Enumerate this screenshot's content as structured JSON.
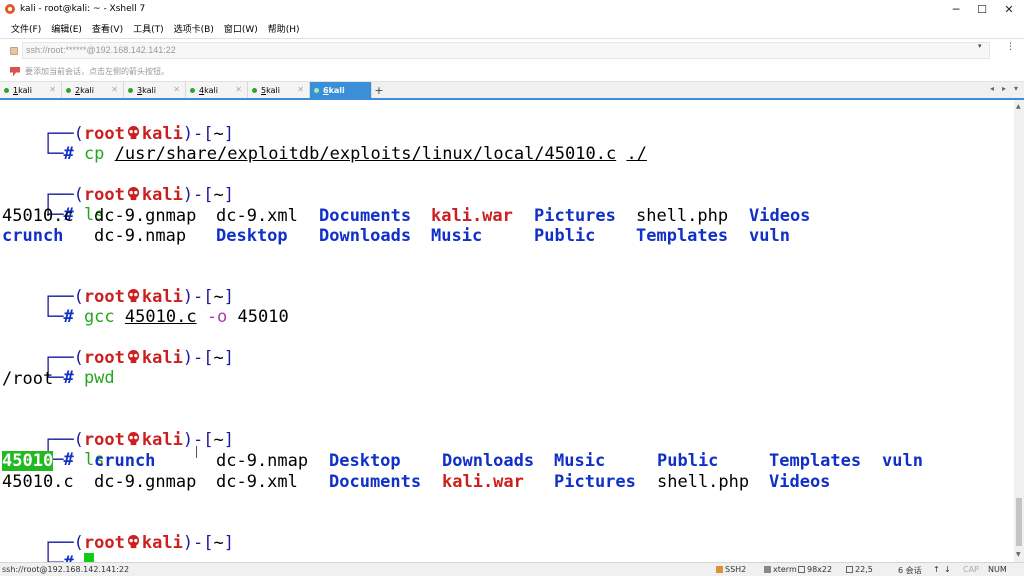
{
  "window": {
    "title": "kali - root@kali: ~ - Xshell 7",
    "minimize": "─",
    "maximize": "☐",
    "close": "✕"
  },
  "menu": [
    "文件(F)",
    "编辑(E)",
    "查看(V)",
    "工具(T)",
    "选项卡(B)",
    "窗口(W)",
    "帮助(H)"
  ],
  "address": {
    "value": "ssh://root:******@192.168.142.141:22",
    "dropdown": "▾",
    "more": "⋮"
  },
  "hint": "要添加当前会话，点击左侧的箭头按钮。",
  "tabs": [
    {
      "num": "1",
      "name": " kali",
      "active": false
    },
    {
      "num": "2",
      "name": " kali",
      "active": false
    },
    {
      "num": "3",
      "name": " kali",
      "active": false
    },
    {
      "num": "4",
      "name": " kali",
      "active": false
    },
    {
      "num": "5",
      "name": " kali",
      "active": false
    },
    {
      "num": "6",
      "name": " kali",
      "active": true
    }
  ],
  "tab_close": "✕",
  "tab_add": "+",
  "tab_nav_left": "◂",
  "tab_nav_right": "▸",
  "tab_menu": "▾",
  "terminal": {
    "prompt_open": "┌──(",
    "prompt_user": "root",
    "prompt_host": "kali",
    "prompt_close": ")-[",
    "prompt_dir": "~",
    "prompt_end": "]",
    "hash_prefix": "└─",
    "hash": "#",
    "cmd1": {
      "cmd": "cp",
      "src": "/usr/share/exploitdb/exploits/linux/local/45010.c",
      "dst": "./"
    },
    "cmd2": {
      "cmd": "ls"
    },
    "ls1_row1": [
      {
        "text": "45010.c",
        "style": "plain"
      },
      {
        "text": "dc-9.gnmap",
        "style": "plain"
      },
      {
        "text": "dc-9.xml",
        "style": "plain"
      },
      {
        "text": "Documents",
        "style": "blue"
      },
      {
        "text": "kali.war",
        "style": "red"
      },
      {
        "text": "Pictures",
        "style": "blue"
      },
      {
        "text": "shell.php",
        "style": "plain"
      },
      {
        "text": "Videos",
        "style": "blue"
      }
    ],
    "ls1_row2": [
      {
        "text": "crunch",
        "style": "blue"
      },
      {
        "text": "dc-9.nmap",
        "style": "plain"
      },
      {
        "text": "Desktop",
        "style": "blue"
      },
      {
        "text": "Downloads",
        "style": "blue"
      },
      {
        "text": "Music",
        "style": "blue"
      },
      {
        "text": "Public",
        "style": "blue"
      },
      {
        "text": "Templates",
        "style": "blue"
      },
      {
        "text": "vuln",
        "style": "blue"
      }
    ],
    "cmd3": {
      "cmd": "gcc",
      "src": "45010.c",
      "flag": "-o",
      "out": "45010"
    },
    "cmd4": {
      "cmd": "pwd",
      "output": "/root"
    },
    "cmd5": {
      "cmd": "ls"
    },
    "ls2_row1": [
      {
        "text": "45010",
        "style": "exe"
      },
      {
        "text": "crunch",
        "style": "blue"
      },
      {
        "text": "dc-9.nmap",
        "style": "plain"
      },
      {
        "text": "Desktop",
        "style": "blue"
      },
      {
        "text": "Downloads",
        "style": "blue"
      },
      {
        "text": "Music",
        "style": "blue"
      },
      {
        "text": "Public",
        "style": "blue"
      },
      {
        "text": "Templates",
        "style": "blue"
      },
      {
        "text": "vuln",
        "style": "blue"
      }
    ],
    "ls2_row2": [
      {
        "text": "45010.c",
        "style": "plain"
      },
      {
        "text": "dc-9.gnmap",
        "style": "plain"
      },
      {
        "text": "dc-9.xml",
        "style": "plain"
      },
      {
        "text": "Documents",
        "style": "blue"
      },
      {
        "text": "kali.war",
        "style": "red"
      },
      {
        "text": "Pictures",
        "style": "blue"
      },
      {
        "text": "shell.php",
        "style": "plain"
      },
      {
        "text": "Videos",
        "style": "blue"
      }
    ]
  },
  "status": {
    "connection": "ssh://root@192.168.142.141:22",
    "protocol": "SSH2",
    "term": "xterm",
    "size": "98x22",
    "pos": "22,5",
    "sessions": "6 会话",
    "up": "↑",
    "down": "↓",
    "cap": "CAP",
    "num": "NUM"
  },
  "colors": {
    "prompt_bracket": "#1a1a9a",
    "prompt_user": "#cc1f1f",
    "command": "#26a61f",
    "directory": "#1030c8",
    "archive": "#cc1f1f",
    "tab_active": "#3b8fd9",
    "cursor": "#12cc12"
  }
}
